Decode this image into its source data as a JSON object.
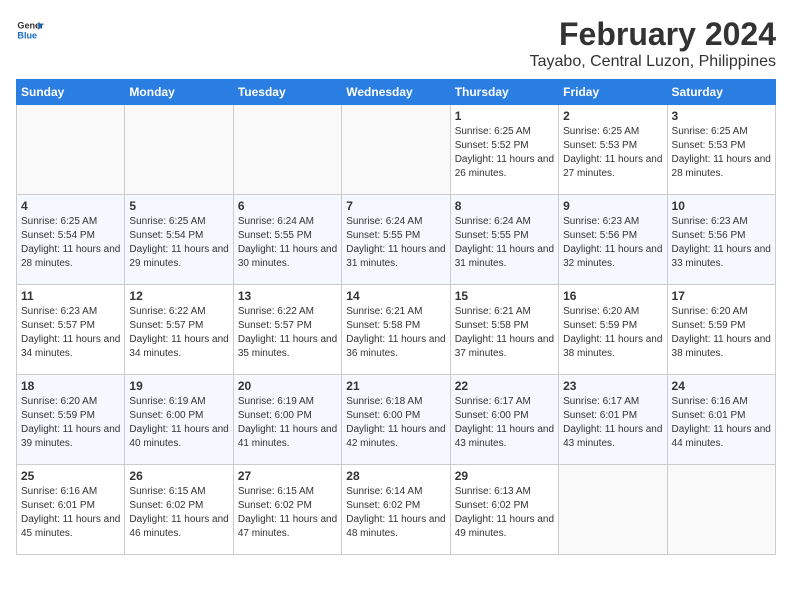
{
  "header": {
    "logo_general": "General",
    "logo_blue": "Blue",
    "month_year": "February 2024",
    "location": "Tayabo, Central Luzon, Philippines"
  },
  "days_of_week": [
    "Sunday",
    "Monday",
    "Tuesday",
    "Wednesday",
    "Thursday",
    "Friday",
    "Saturday"
  ],
  "weeks": [
    [
      {
        "day": "",
        "empty": true
      },
      {
        "day": "",
        "empty": true
      },
      {
        "day": "",
        "empty": true
      },
      {
        "day": "",
        "empty": true
      },
      {
        "day": "1",
        "sunrise": "Sunrise: 6:25 AM",
        "sunset": "Sunset: 5:52 PM",
        "daylight": "Daylight: 11 hours and 26 minutes."
      },
      {
        "day": "2",
        "sunrise": "Sunrise: 6:25 AM",
        "sunset": "Sunset: 5:53 PM",
        "daylight": "Daylight: 11 hours and 27 minutes."
      },
      {
        "day": "3",
        "sunrise": "Sunrise: 6:25 AM",
        "sunset": "Sunset: 5:53 PM",
        "daylight": "Daylight: 11 hours and 28 minutes."
      }
    ],
    [
      {
        "day": "4",
        "sunrise": "Sunrise: 6:25 AM",
        "sunset": "Sunset: 5:54 PM",
        "daylight": "Daylight: 11 hours and 28 minutes."
      },
      {
        "day": "5",
        "sunrise": "Sunrise: 6:25 AM",
        "sunset": "Sunset: 5:54 PM",
        "daylight": "Daylight: 11 hours and 29 minutes."
      },
      {
        "day": "6",
        "sunrise": "Sunrise: 6:24 AM",
        "sunset": "Sunset: 5:55 PM",
        "daylight": "Daylight: 11 hours and 30 minutes."
      },
      {
        "day": "7",
        "sunrise": "Sunrise: 6:24 AM",
        "sunset": "Sunset: 5:55 PM",
        "daylight": "Daylight: 11 hours and 31 minutes."
      },
      {
        "day": "8",
        "sunrise": "Sunrise: 6:24 AM",
        "sunset": "Sunset: 5:55 PM",
        "daylight": "Daylight: 11 hours and 31 minutes."
      },
      {
        "day": "9",
        "sunrise": "Sunrise: 6:23 AM",
        "sunset": "Sunset: 5:56 PM",
        "daylight": "Daylight: 11 hours and 32 minutes."
      },
      {
        "day": "10",
        "sunrise": "Sunrise: 6:23 AM",
        "sunset": "Sunset: 5:56 PM",
        "daylight": "Daylight: 11 hours and 33 minutes."
      }
    ],
    [
      {
        "day": "11",
        "sunrise": "Sunrise: 6:23 AM",
        "sunset": "Sunset: 5:57 PM",
        "daylight": "Daylight: 11 hours and 34 minutes."
      },
      {
        "day": "12",
        "sunrise": "Sunrise: 6:22 AM",
        "sunset": "Sunset: 5:57 PM",
        "daylight": "Daylight: 11 hours and 34 minutes."
      },
      {
        "day": "13",
        "sunrise": "Sunrise: 6:22 AM",
        "sunset": "Sunset: 5:57 PM",
        "daylight": "Daylight: 11 hours and 35 minutes."
      },
      {
        "day": "14",
        "sunrise": "Sunrise: 6:21 AM",
        "sunset": "Sunset: 5:58 PM",
        "daylight": "Daylight: 11 hours and 36 minutes."
      },
      {
        "day": "15",
        "sunrise": "Sunrise: 6:21 AM",
        "sunset": "Sunset: 5:58 PM",
        "daylight": "Daylight: 11 hours and 37 minutes."
      },
      {
        "day": "16",
        "sunrise": "Sunrise: 6:20 AM",
        "sunset": "Sunset: 5:59 PM",
        "daylight": "Daylight: 11 hours and 38 minutes."
      },
      {
        "day": "17",
        "sunrise": "Sunrise: 6:20 AM",
        "sunset": "Sunset: 5:59 PM",
        "daylight": "Daylight: 11 hours and 38 minutes."
      }
    ],
    [
      {
        "day": "18",
        "sunrise": "Sunrise: 6:20 AM",
        "sunset": "Sunset: 5:59 PM",
        "daylight": "Daylight: 11 hours and 39 minutes."
      },
      {
        "day": "19",
        "sunrise": "Sunrise: 6:19 AM",
        "sunset": "Sunset: 6:00 PM",
        "daylight": "Daylight: 11 hours and 40 minutes."
      },
      {
        "day": "20",
        "sunrise": "Sunrise: 6:19 AM",
        "sunset": "Sunset: 6:00 PM",
        "daylight": "Daylight: 11 hours and 41 minutes."
      },
      {
        "day": "21",
        "sunrise": "Sunrise: 6:18 AM",
        "sunset": "Sunset: 6:00 PM",
        "daylight": "Daylight: 11 hours and 42 minutes."
      },
      {
        "day": "22",
        "sunrise": "Sunrise: 6:17 AM",
        "sunset": "Sunset: 6:00 PM",
        "daylight": "Daylight: 11 hours and 43 minutes."
      },
      {
        "day": "23",
        "sunrise": "Sunrise: 6:17 AM",
        "sunset": "Sunset: 6:01 PM",
        "daylight": "Daylight: 11 hours and 43 minutes."
      },
      {
        "day": "24",
        "sunrise": "Sunrise: 6:16 AM",
        "sunset": "Sunset: 6:01 PM",
        "daylight": "Daylight: 11 hours and 44 minutes."
      }
    ],
    [
      {
        "day": "25",
        "sunrise": "Sunrise: 6:16 AM",
        "sunset": "Sunset: 6:01 PM",
        "daylight": "Daylight: 11 hours and 45 minutes."
      },
      {
        "day": "26",
        "sunrise": "Sunrise: 6:15 AM",
        "sunset": "Sunset: 6:02 PM",
        "daylight": "Daylight: 11 hours and 46 minutes."
      },
      {
        "day": "27",
        "sunrise": "Sunrise: 6:15 AM",
        "sunset": "Sunset: 6:02 PM",
        "daylight": "Daylight: 11 hours and 47 minutes."
      },
      {
        "day": "28",
        "sunrise": "Sunrise: 6:14 AM",
        "sunset": "Sunset: 6:02 PM",
        "daylight": "Daylight: 11 hours and 48 minutes."
      },
      {
        "day": "29",
        "sunrise": "Sunrise: 6:13 AM",
        "sunset": "Sunset: 6:02 PM",
        "daylight": "Daylight: 11 hours and 49 minutes."
      },
      {
        "day": "",
        "empty": true
      },
      {
        "day": "",
        "empty": true
      }
    ]
  ]
}
